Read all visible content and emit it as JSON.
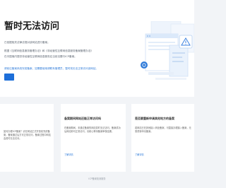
{
  "hero": {
    "title": "暂时无法访问",
    "line1": "已依据相关法律法规对该网站进行备案。",
    "line2": "根据《互联网信息服务管理办法》和《非经营性互联网信息服务备案管理办法》",
    "line3": "在中国境内提供非经营性互联网信息服务应当依法履行ICP备案。",
    "notice": "请前往备案系统完成备案，如需要使用请联系管理员，暂时将无法正常访问该网站。",
    "button_label": ""
  },
  "cards": [
    {
      "title": "",
      "desc": "如何办理ICP备案？请在网站正式开放前完成备案，备案通过后方可正常访问，备案过程中网站会暂时无法访问。",
      "link": ""
    },
    {
      "title": "备案期间网站还能正常访问吗",
      "desc": "在备案期间，未通过备案的网站暂时无法访问，备案成功后网站即可正常访问，请耐心等待备案审核结果。",
      "link": "了解详情"
    },
    {
      "title": "是否要重新申请其他地方的备案",
      "desc": "若网站已在其他接入商处备案，可直接办理接入备案，无需重新申请备案。",
      "link": "了解详情"
    }
  ],
  "footer": {
    "text": "ICP备案检测服务"
  },
  "colors": {
    "accent": "#1e6fd9",
    "link": "#2f7bd9",
    "background": "#f2f4f7"
  }
}
